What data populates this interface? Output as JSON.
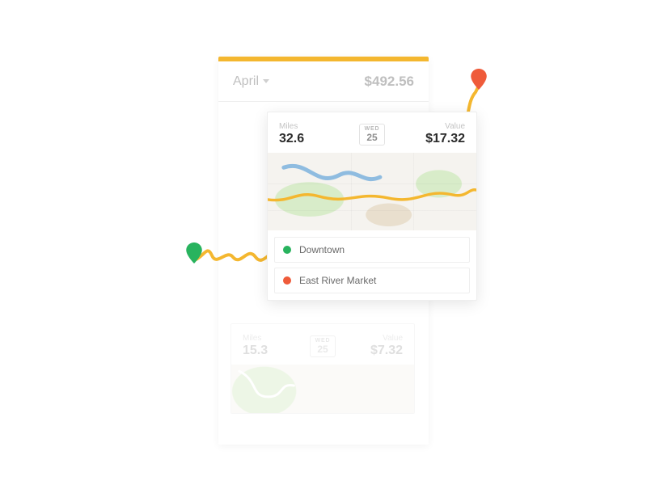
{
  "colors": {
    "accent": "#f4b72f",
    "start_pin": "#28b35e",
    "end_pin": "#ef5b3a",
    "start_dot": "#28b35e",
    "end_dot": "#ef5b3a"
  },
  "header": {
    "month_label": "April",
    "total": "$492.56"
  },
  "trips": [
    {
      "miles_label": "Miles",
      "miles_value": "32.6",
      "value_label": "Value",
      "value_amount": "$17.32",
      "date": {
        "dow": "WED",
        "day": "25"
      },
      "places": [
        {
          "name": "Downtown",
          "dot": "start"
        },
        {
          "name": "East River Market",
          "dot": "end"
        }
      ]
    },
    {
      "miles_label": "Miles",
      "miles_value": "15.3",
      "value_label": "Value",
      "value_amount": "$7.32",
      "date": {
        "dow": "WED",
        "day": "25"
      }
    }
  ]
}
